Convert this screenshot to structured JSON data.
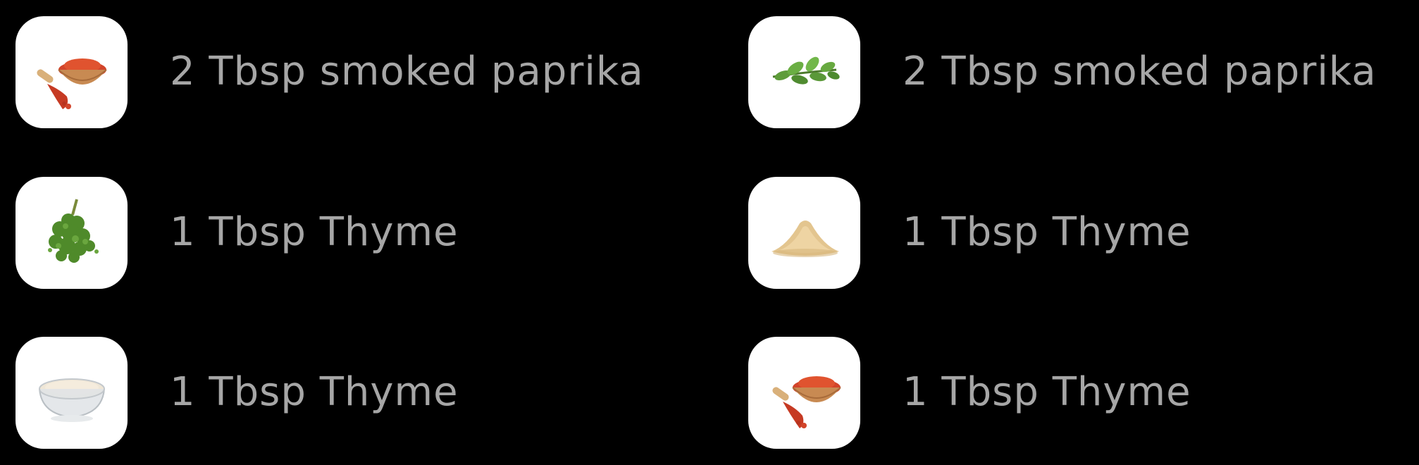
{
  "ingredients": [
    {
      "label": "2 Tbsp smoked paprika",
      "icon": "paprika-bowl-icon"
    },
    {
      "label": "2 Tbsp smoked paprika",
      "icon": "herb-leaves-icon"
    },
    {
      "label": "1 Tbsp Thyme",
      "icon": "thyme-bunch-icon"
    },
    {
      "label": "1 Tbsp Thyme",
      "icon": "powder-pile-icon"
    },
    {
      "label": "1 Tbsp Thyme",
      "icon": "glass-bowl-powder-icon"
    },
    {
      "label": "1 Tbsp Thyme",
      "icon": "paprika-bowl-icon"
    }
  ],
  "colors": {
    "background": "#000000",
    "label": "#a6a6a6",
    "tile": "#ffffff"
  }
}
